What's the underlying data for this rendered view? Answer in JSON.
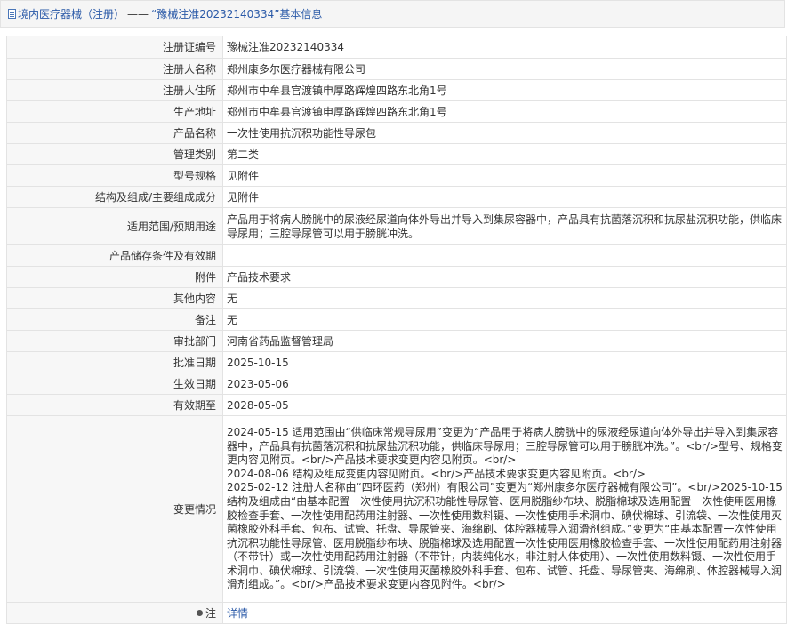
{
  "header": {
    "breadcrumb_link": "境内医疗器械（注册）",
    "separator": "——",
    "title": "“豫械注准20232140334”基本信息"
  },
  "rows": [
    {
      "label": "注册证编号",
      "value": "豫械注准20232140334"
    },
    {
      "label": "注册人名称",
      "value": "郑州康多尔医疗器械有限公司"
    },
    {
      "label": "注册人住所",
      "value": "郑州市中牟县官渡镇申厚路辉煌四路东北角1号"
    },
    {
      "label": "生产地址",
      "value": "郑州市中牟县官渡镇申厚路辉煌四路东北角1号"
    },
    {
      "label": "产品名称",
      "value": "一次性使用抗沉积功能性导尿包"
    },
    {
      "label": "管理类别",
      "value": "第二类"
    },
    {
      "label": "型号规格",
      "value": "见附件"
    },
    {
      "label": "结构及组成/主要组成成分",
      "value": "见附件"
    },
    {
      "label": "适用范围/预期用途",
      "value": "产品用于将病人膀胱中的尿液经尿道向体外导出并导入到集尿容器中，产品具有抗菌落沉积和抗尿盐沉积功能，供临床导尿用；三腔导尿管可以用于膀胱冲洗。"
    },
    {
      "label": "产品储存条件及有效期",
      "value": ""
    },
    {
      "label": "附件",
      "value": "产品技术要求"
    },
    {
      "label": "其他内容",
      "value": "无"
    },
    {
      "label": "备注",
      "value": "无"
    },
    {
      "label": "审批部门",
      "value": "河南省药品监督管理局"
    },
    {
      "label": "批准日期",
      "value": "2025-10-15"
    },
    {
      "label": "生效日期",
      "value": "2023-05-06"
    },
    {
      "label": "有效期至",
      "value": "2028-05-05"
    },
    {
      "label": "变更情况",
      "value": "2024-05-15 适用范围由“供临床常规导尿用”变更为“产品用于将病人膀胱中的尿液经尿道向体外导出并导入到集尿容器中，产品具有抗菌落沉积和抗尿盐沉积功能，供临床导尿用；三腔导尿管可以用于膀胱冲洗。”。<br/>型号、规格变更内容见附页。<br/>产品技术要求变更内容见附页。<br/>\n2024-08-06 结构及组成变更内容见附页。<br/>产品技术要求变更内容见附页。<br/>\n2025-02-12 注册人名称由“四环医药（郑州）有限公司”变更为“郑州康多尔医疗器械有限公司”。<br/>2025-10-15结构及组成由“由基本配置一次性使用抗沉积功能性导尿管、医用脱脂纱布块、脱脂棉球及选用配置一次性使用医用橡胶检查手套、一次性使用配药用注射器、一次性使用数料镊、一次性使用手术洞巾、碘伏棉球、引流袋、一次性使用灭菌橡胶外科手套、包布、试管、托盘、导尿管夹、海绵刷、体腔器械导入润滑剂组成。”变更为“由基本配置一次性使用抗沉积功能性导尿管、医用脱脂纱布块、脱脂棉球及选用配置一次性使用医用橡胶检查手套、一次性使用配药用注射器（不带针）或一次性使用配药用注射器（不带针，内装纯化水，非注射人体使用）、一次性使用数料镊、一次性使用手术洞巾、碘伏棉球、引流袋、一次性使用灭菌橡胶外科手套、包布、试管、托盘、导尿管夹、海绵刷、体腔器械导入润滑剂组成。”。<br/>产品技术要求变更内容见附件。<br/>"
    }
  ],
  "note": {
    "label": "注",
    "icon": "bulb-icon",
    "link_text": "详情"
  }
}
